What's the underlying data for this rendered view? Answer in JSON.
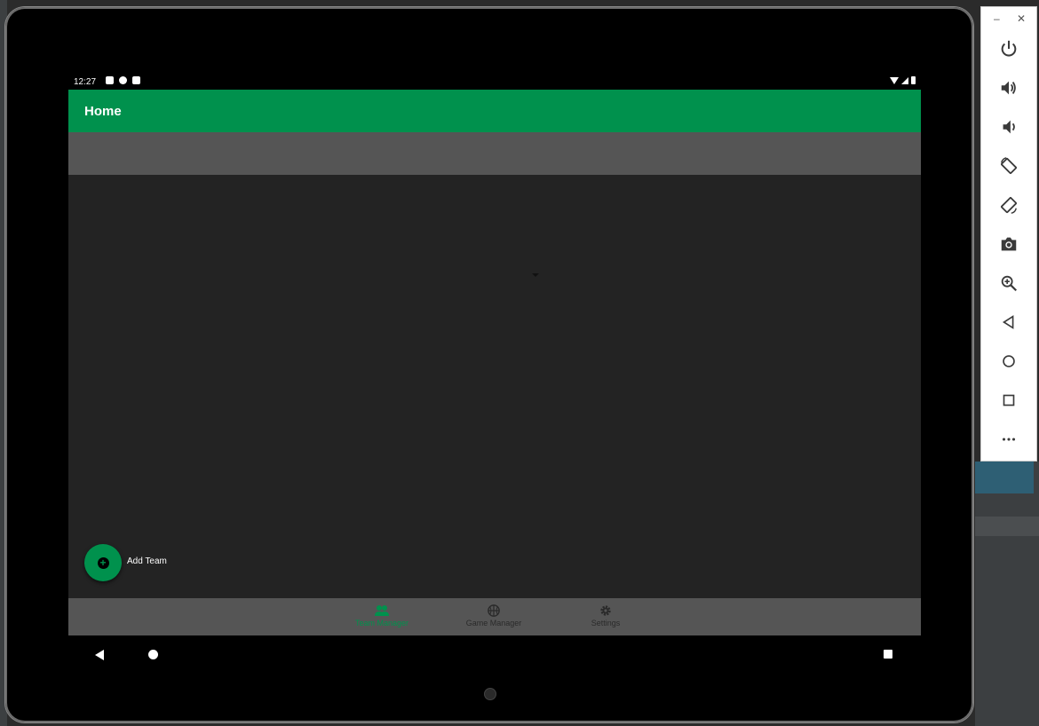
{
  "status_bar": {
    "time": "12:27"
  },
  "app_bar": {
    "title": "Home"
  },
  "fab": {
    "label": "Add Team",
    "icon": "plus-circle-icon"
  },
  "bottom_nav": {
    "items": [
      {
        "label": "Team Manager",
        "icon": "people-icon",
        "active": true
      },
      {
        "label": "Game Manager",
        "icon": "basketball-icon",
        "active": false
      },
      {
        "label": "Settings",
        "icon": "gear-icon",
        "active": false
      }
    ]
  },
  "emulator_toolbar": {
    "window_controls": {
      "minimize": "–",
      "close": "✕"
    },
    "buttons": [
      "power-icon",
      "volume-up-icon",
      "volume-down-icon",
      "rotate-left-icon",
      "rotate-right-icon",
      "camera-icon",
      "zoom-in-icon",
      "back-icon",
      "home-icon",
      "overview-icon",
      "more-icon"
    ]
  },
  "colors": {
    "primary": "#00914d",
    "surface": "#555555",
    "background": "#232323"
  }
}
